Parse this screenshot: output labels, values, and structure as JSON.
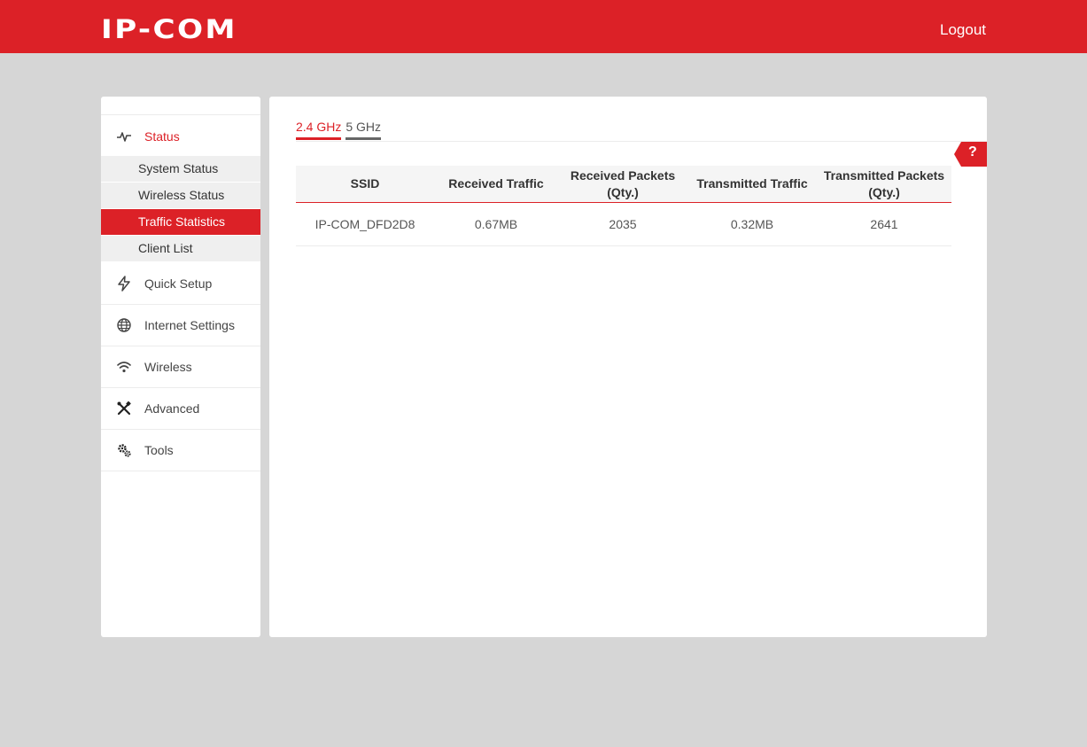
{
  "header": {
    "logo": "IP-COM",
    "logout_label": "Logout"
  },
  "sidebar": {
    "items": [
      {
        "label": "Status",
        "icon": "pulse-icon"
      },
      {
        "label": "Quick Setup",
        "icon": "lightning-icon"
      },
      {
        "label": "Internet Settings",
        "icon": "globe-icon"
      },
      {
        "label": "Wireless",
        "icon": "wifi-icon"
      },
      {
        "label": "Advanced",
        "icon": "tools-icon"
      },
      {
        "label": "Tools",
        "icon": "gears-icon"
      }
    ],
    "status_subitems": [
      {
        "label": "System Status"
      },
      {
        "label": "Wireless Status"
      },
      {
        "label": "Traffic Statistics",
        "selected": true
      },
      {
        "label": "Client List"
      }
    ]
  },
  "main": {
    "tabs": [
      {
        "label": "2.4 GHz",
        "active": true
      },
      {
        "label": "5 GHz",
        "active": false
      }
    ],
    "help_label": "?",
    "table": {
      "headers": [
        "SSID",
        "Received Traffic",
        "Received Packets (Qty.)",
        "Transmitted Traffic",
        "Transmitted Packets (Qty.)"
      ],
      "rows": [
        [
          "IP-COM_DFD2D8",
          "0.67MB",
          "2035",
          "0.32MB",
          "2641"
        ]
      ]
    }
  },
  "colors": {
    "brand": "#dc2127",
    "background": "#d6d6d6"
  }
}
